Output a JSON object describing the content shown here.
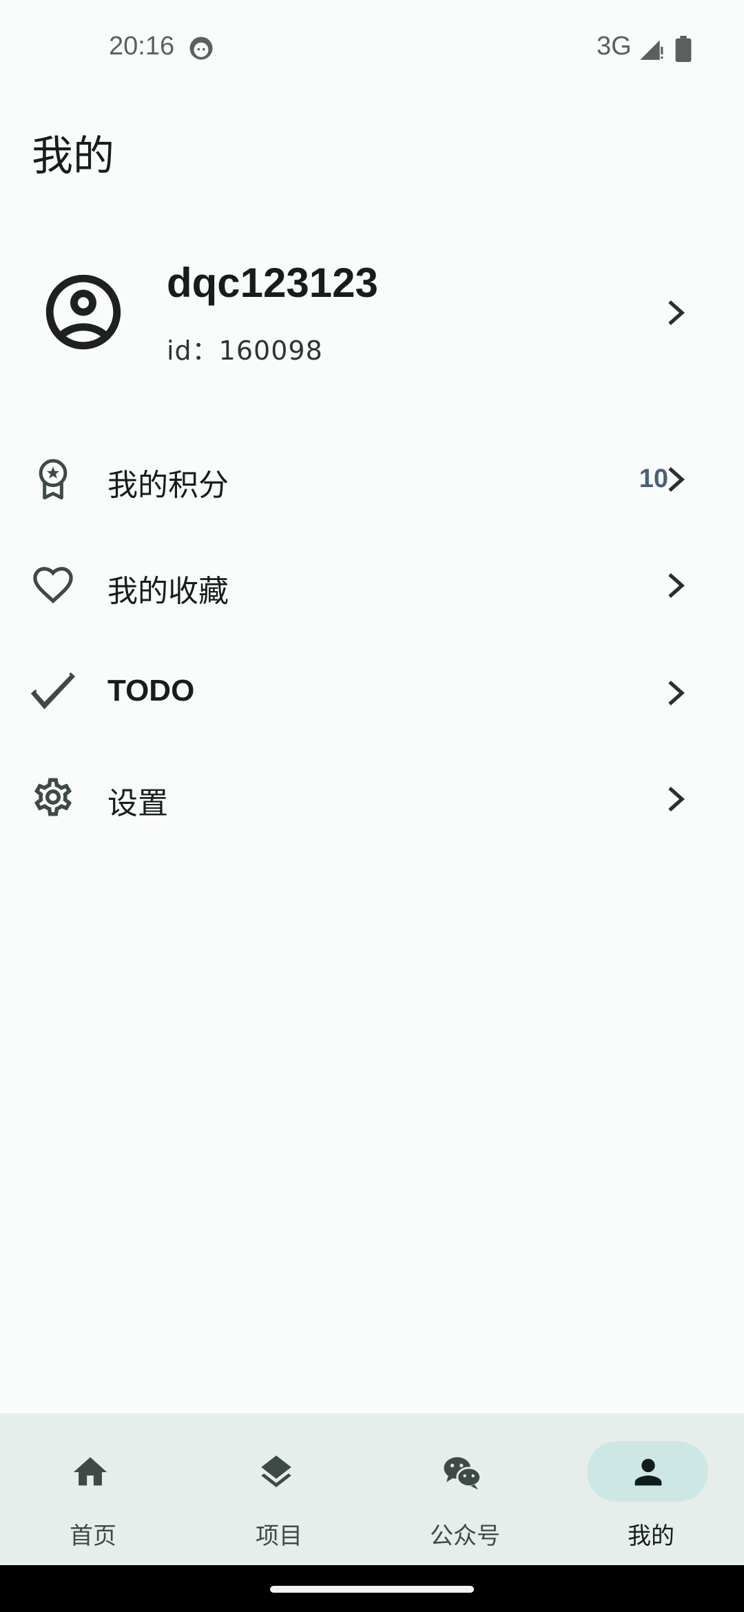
{
  "status_bar": {
    "time": "20:16",
    "network": "3G",
    "icons": [
      "face-icon",
      "signal-icon",
      "battery-icon"
    ]
  },
  "header": {
    "title": "我的"
  },
  "profile": {
    "username": "dqc123123",
    "user_id": "id：160098",
    "icon": "account-circle-icon"
  },
  "menu": {
    "items": [
      {
        "label": "我的积分",
        "value": "10",
        "icon": "award-icon"
      },
      {
        "label": "我的收藏",
        "value": "",
        "icon": "heart-icon"
      },
      {
        "label": "TODO",
        "value": "",
        "icon": "check-icon"
      },
      {
        "label": "设置",
        "value": "",
        "icon": "gear-icon"
      }
    ]
  },
  "bottom_nav": {
    "items": [
      {
        "label": "首页",
        "icon": "home-icon",
        "active": false
      },
      {
        "label": "项目",
        "icon": "layers-icon",
        "active": false
      },
      {
        "label": "公众号",
        "icon": "wechat-icon",
        "active": false
      },
      {
        "label": "我的",
        "icon": "person-icon",
        "active": true
      }
    ]
  },
  "colors": {
    "background": "#f9fcfb",
    "nav_background": "#e6eeec",
    "nav_active_pill": "#cde8e4",
    "points_value": "#4a6079",
    "text_primary": "#191c1c",
    "icon": "#3f4948"
  }
}
